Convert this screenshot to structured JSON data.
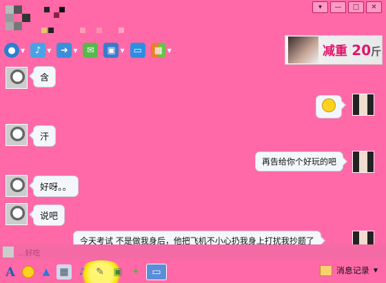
{
  "window": {
    "controls": [
      "▾",
      "—",
      "□",
      "✕"
    ]
  },
  "toolbar": {
    "items": [
      {
        "name": "video-call-icon",
        "color": "#2c7fd1"
      },
      {
        "name": "voice-call-icon",
        "color": "#4aa2e5"
      },
      {
        "name": "file-transfer-icon",
        "color": "#3b8fd8"
      },
      {
        "name": "sms-icon",
        "color": "#57b84c"
      },
      {
        "name": "remote-assist-icon",
        "color": "#3a7cc9"
      },
      {
        "name": "share-screen-icon",
        "color": "#2d8ee1"
      },
      {
        "name": "apps-icon",
        "color": "#e97f2b"
      }
    ]
  },
  "ad": {
    "text": "减重",
    "number": "20",
    "unit": "斤"
  },
  "messages": [
    {
      "side": "left",
      "text": "含"
    },
    {
      "side": "right",
      "text": ""
    },
    {
      "side": "left",
      "text": "汗"
    },
    {
      "side": "right",
      "text": "再告给你个好玩的吧"
    },
    {
      "side": "left",
      "text": "好呀。。"
    },
    {
      "side": "left",
      "text": "说吧"
    },
    {
      "side": "right",
      "text": "今天考试  不是做我身后，他把飞机不小心扔我身上打扰我抄题了"
    }
  ],
  "input": {
    "text": "...好吃"
  },
  "bottombar": {
    "history_label": "消息记录",
    "icons": [
      "font-icon",
      "smiley-icon",
      "nudge-icon",
      "image-icon",
      "voice-message-icon",
      "handwrite-icon",
      "screenshot-icon",
      "gift-icon",
      "tool-icon"
    ]
  },
  "colors": {
    "background": "#ff69a8",
    "bubble": "#f3f7fb"
  }
}
